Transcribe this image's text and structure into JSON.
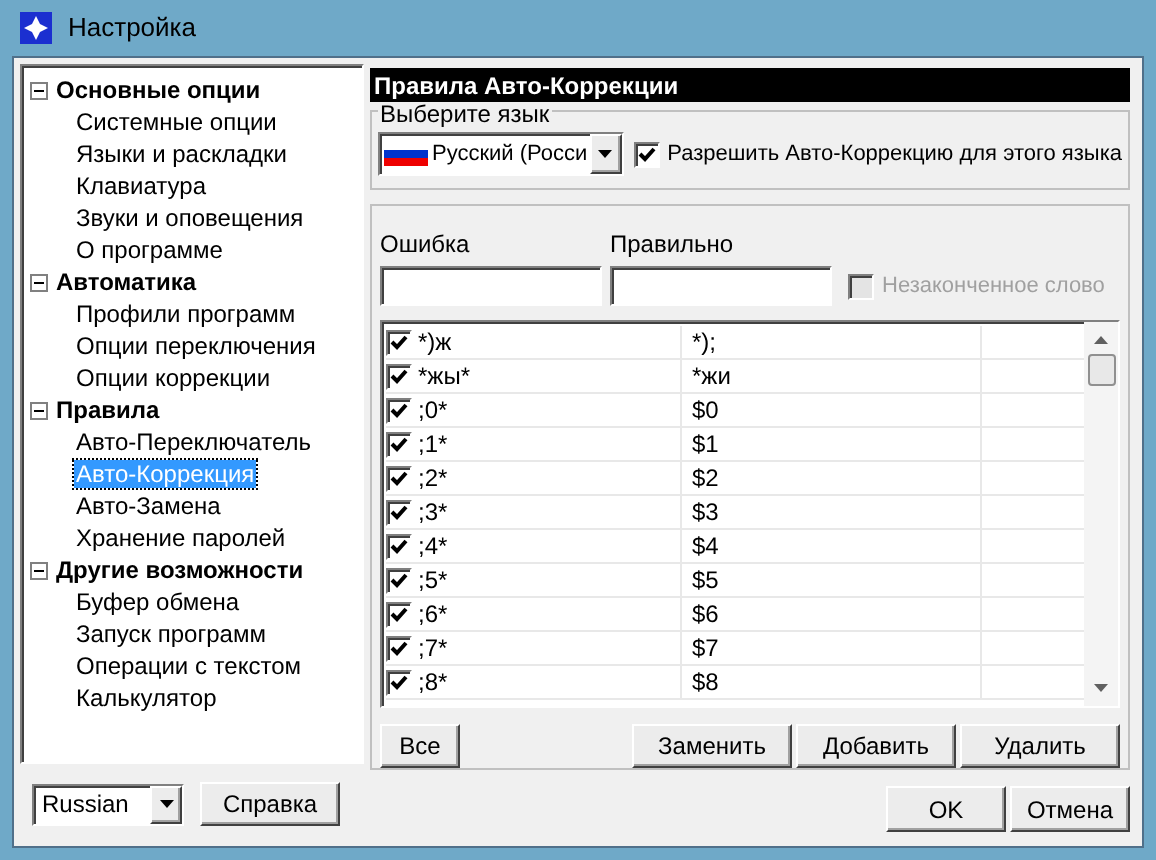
{
  "window": {
    "title": "Настройка"
  },
  "tree": [
    {
      "label": "Основные опции",
      "expanded": true,
      "selected": false,
      "children": [
        {
          "label": "Системные опции",
          "selected": false
        },
        {
          "label": "Языки и раскладки",
          "selected": false
        },
        {
          "label": "Клавиатура",
          "selected": false
        },
        {
          "label": "Звуки и оповещения",
          "selected": false
        },
        {
          "label": "О программе",
          "selected": false
        }
      ]
    },
    {
      "label": "Автоматика",
      "expanded": true,
      "selected": false,
      "children": [
        {
          "label": "Профили программ",
          "selected": false
        },
        {
          "label": "Опции переключения",
          "selected": false
        },
        {
          "label": "Опции коррекции",
          "selected": false
        }
      ]
    },
    {
      "label": "Правила",
      "expanded": true,
      "selected": false,
      "children": [
        {
          "label": "Авто-Переключатель",
          "selected": false
        },
        {
          "label": "Авто-Коррекция",
          "selected": true
        },
        {
          "label": "Авто-Замена",
          "selected": false
        },
        {
          "label": "Хранение паролей",
          "selected": false
        }
      ]
    },
    {
      "label": "Другие возможности",
      "expanded": true,
      "selected": false,
      "children": [
        {
          "label": "Буфер обмена",
          "selected": false
        },
        {
          "label": "Запуск программ",
          "selected": false
        },
        {
          "label": "Операции с текстом",
          "selected": false
        },
        {
          "label": "Калькулятор",
          "selected": false
        }
      ]
    }
  ],
  "ui_language": {
    "value": "Russian"
  },
  "help_button": "Справка",
  "panel_title": "Правила Авто-Коррекции",
  "language_group": {
    "label": "Выберите язык",
    "value": "Русский (Росси",
    "enable_checkbox": {
      "label": "Разрешить Авто-Коррекцию для этого языка",
      "checked": true
    }
  },
  "fields": {
    "error_label": "Ошибка",
    "correct_label": "Правильно",
    "unfinished": {
      "label": "Незаконченное слово",
      "checked": false,
      "disabled": true
    }
  },
  "rules": [
    {
      "checked": true,
      "error": "*)ж",
      "correct": "*);"
    },
    {
      "checked": true,
      "error": "*жы*",
      "correct": "*жи"
    },
    {
      "checked": true,
      "error": ";0*",
      "correct": "$0"
    },
    {
      "checked": true,
      "error": ";1*",
      "correct": "$1"
    },
    {
      "checked": true,
      "error": ";2*",
      "correct": "$2"
    },
    {
      "checked": true,
      "error": ";3*",
      "correct": "$3"
    },
    {
      "checked": true,
      "error": ";4*",
      "correct": "$4"
    },
    {
      "checked": true,
      "error": ";5*",
      "correct": "$5"
    },
    {
      "checked": true,
      "error": ";6*",
      "correct": "$6"
    },
    {
      "checked": true,
      "error": ";7*",
      "correct": "$7"
    },
    {
      "checked": true,
      "error": ";8*",
      "correct": "$8"
    }
  ],
  "list_buttons": {
    "all": "Все",
    "actions": [
      "Заменить",
      "Добавить",
      "Удалить"
    ]
  },
  "dialog_buttons": [
    "OK",
    "Отмена"
  ]
}
